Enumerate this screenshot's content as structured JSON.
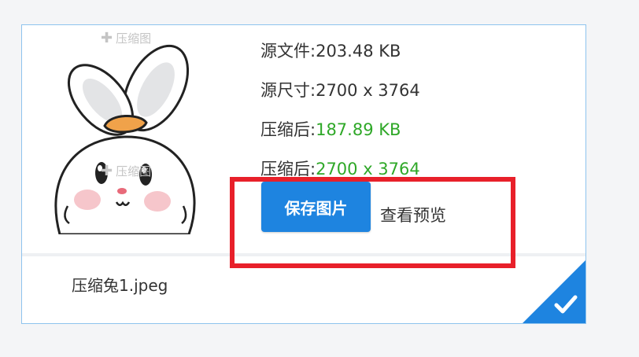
{
  "file": {
    "watermark_text": "压缩图",
    "source_size_label": "源文件:",
    "source_size_value": "203.48 KB",
    "source_dim_label": "源尺寸:",
    "source_dim_value": "2700 x 3764",
    "compressed_size_label": "压缩后:",
    "compressed_size_value": "187.89 KB",
    "compressed_dim_label": "压缩后:",
    "compressed_dim_value": "2700 x 3764",
    "filename": "压缩兔1.jpeg"
  },
  "actions": {
    "save_label": "保存图片",
    "preview_label": "查看预览"
  },
  "colors": {
    "accent": "#1e84e0",
    "success": "#2fa828",
    "highlight": "#e8202a"
  },
  "icons": {
    "selected": "checkmark-icon",
    "watermark": "plus-icon"
  }
}
